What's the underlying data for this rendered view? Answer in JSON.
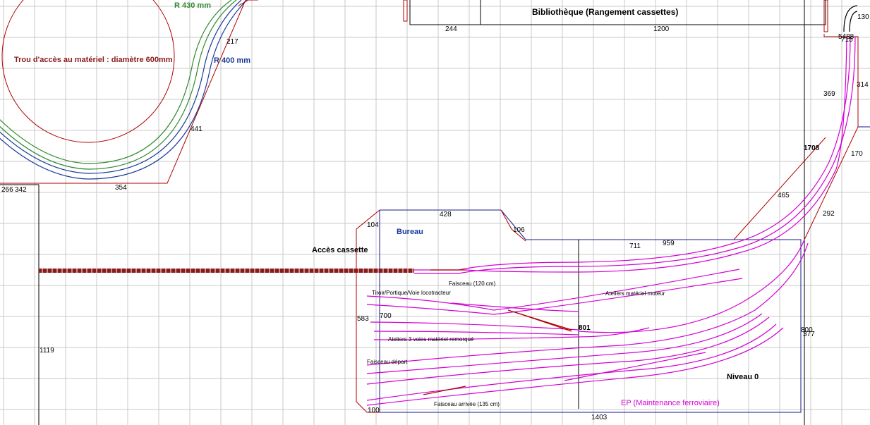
{
  "labels": {
    "access_hole": "Trou d'accès au matériel : diamètre 600mm",
    "radius_430": "R 430 mm",
    "radius_400": "R 400 mm",
    "library": "Bibliothèque (Rangement cassettes)",
    "office": "Bureau",
    "cassette_access": "Accès cassette",
    "level": "Niveau 0",
    "maintenance": "EP (Maintenance ferroviaire)",
    "yard_120": "Faisceau (120 cm)",
    "drawer": "Tiroir/Portique/Voie locotracteur",
    "engine_workshop": "Ateliers matériel moteur",
    "towed_workshop": "Ateliers 3 voies matériel remorqué",
    "departure_yard": "Faisceau départ",
    "arrival_yard": "Faisceau arrivée (135 cm)"
  },
  "dimensions": {
    "d217": "217",
    "d441": "441",
    "d354": "354",
    "d266": "266",
    "d342": "342",
    "d244": "244",
    "d1200": "1200",
    "d130": "130",
    "d54": "5488",
    "d715": "715",
    "d369": "369",
    "d314": "314",
    "d1708": "1708",
    "d170": "170",
    "d465": "465",
    "d292": "292",
    "d428": "428",
    "d104": "104",
    "d106": "106",
    "d711": "711",
    "d959": "959",
    "d583": "583",
    "d700": "700",
    "d801": "801",
    "d800": "800",
    "d377": "377",
    "d1119": "1119",
    "d100": "100",
    "d1403": "1403"
  },
  "colors": {
    "grid": "#c8c8c8",
    "wall": "#b00000",
    "track": "#d400d4",
    "green_track": "#2e8b2e",
    "blue_track": "#1a3a9a",
    "office": "#1a1a8c",
    "cassette": "#8b1a1a"
  }
}
